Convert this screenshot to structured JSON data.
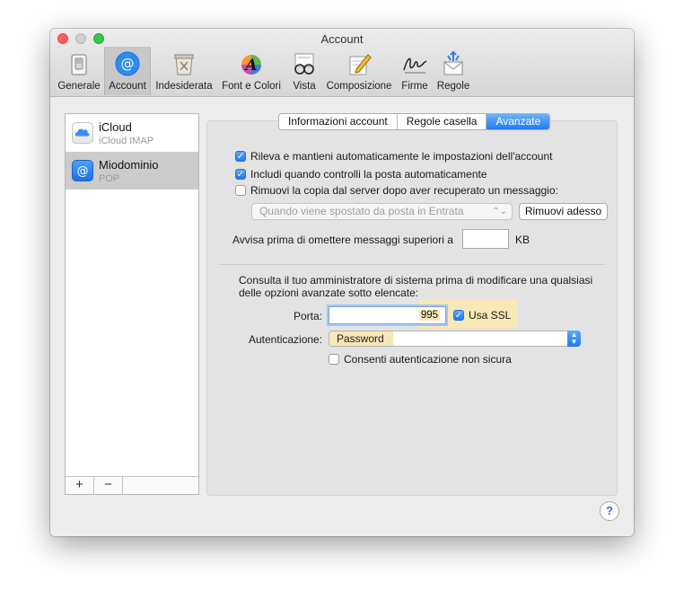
{
  "window": {
    "title": "Account"
  },
  "toolbar": {
    "items": [
      {
        "label": "Generale",
        "icon": "switch-icon"
      },
      {
        "label": "Account",
        "icon": "at-sign-icon",
        "selected": true
      },
      {
        "label": "Indesiderata",
        "icon": "junk-bin-icon"
      },
      {
        "label": "Font e Colori",
        "icon": "font-colors-icon"
      },
      {
        "label": "Vista",
        "icon": "glasses-icon"
      },
      {
        "label": "Composizione",
        "icon": "compose-pencil-icon"
      },
      {
        "label": "Firme",
        "icon": "signature-icon"
      },
      {
        "label": "Regole",
        "icon": "rules-envelope-icon"
      }
    ]
  },
  "sidebar": {
    "accounts": [
      {
        "name": "iCloud",
        "type": "iCloud IMAP",
        "icon": "cloud-icon"
      },
      {
        "name": "Miodominio",
        "type": "POP",
        "icon": "at-sign-icon",
        "selected": true
      }
    ],
    "add_label": "+",
    "remove_label": "−"
  },
  "tabs": [
    {
      "label": "Informazioni account"
    },
    {
      "label": "Regole casella"
    },
    {
      "label": "Avanzate",
      "active": true
    }
  ],
  "advanced": {
    "opt_auto_detect": {
      "label": "Rileva e mantieni automaticamente le impostazioni dell'account",
      "checked": true
    },
    "opt_include_check": {
      "label": "Includi quando controlli la posta automaticamente",
      "checked": true
    },
    "opt_remove_copy": {
      "label": "Rimuovi la copia dal server dopo aver recuperato un messaggio:",
      "checked": false
    },
    "remove_when": {
      "value": "Quando viene spostato da posta in Entrata"
    },
    "remove_now_label": "Rimuovi adesso",
    "warn_label": "Avvisa prima di omettere messaggi superiori a",
    "warn_value": "",
    "warn_unit": "KB",
    "admin_note_line1": "Consulta il tuo amministratore di sistema prima di modificare una qualsiasi",
    "admin_note_line2": "delle opzioni avanzate sotto elencate:",
    "port_label": "Porta:",
    "port_value": "995",
    "ssl_label": "Usa SSL",
    "ssl_checked": true,
    "auth_label": "Autenticazione:",
    "auth_value": "Password",
    "insecure_auth": {
      "label": "Consenti autenticazione non sicura",
      "checked": false
    }
  },
  "help_label": "?",
  "colors": {
    "accent": "#1f78f0",
    "highlight": "#f7e8b6",
    "close": "#fc605c",
    "maximize": "#34c84a"
  }
}
